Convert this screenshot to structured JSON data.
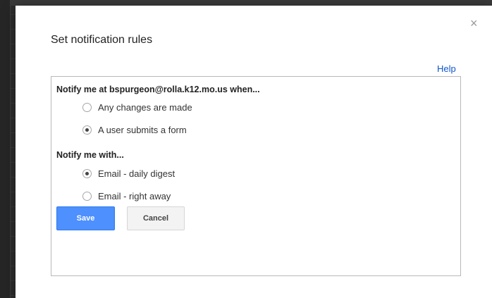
{
  "dialog": {
    "title": "Set notification rules",
    "help_label": "Help",
    "close_glyph": "×"
  },
  "when": {
    "heading": "Notify me at bspurgeon@rolla.k12.mo.us when...",
    "options": [
      {
        "label": "Any changes are made",
        "checked": false
      },
      {
        "label": "A user submits a form",
        "checked": true
      }
    ]
  },
  "with": {
    "heading": "Notify me with...",
    "options": [
      {
        "label": "Email - daily digest",
        "checked": true
      },
      {
        "label": "Email - right away",
        "checked": false
      }
    ]
  },
  "buttons": {
    "save_label": "Save",
    "cancel_label": "Cancel"
  },
  "colors": {
    "accent": "#4d90fe",
    "link": "#1155cc"
  }
}
